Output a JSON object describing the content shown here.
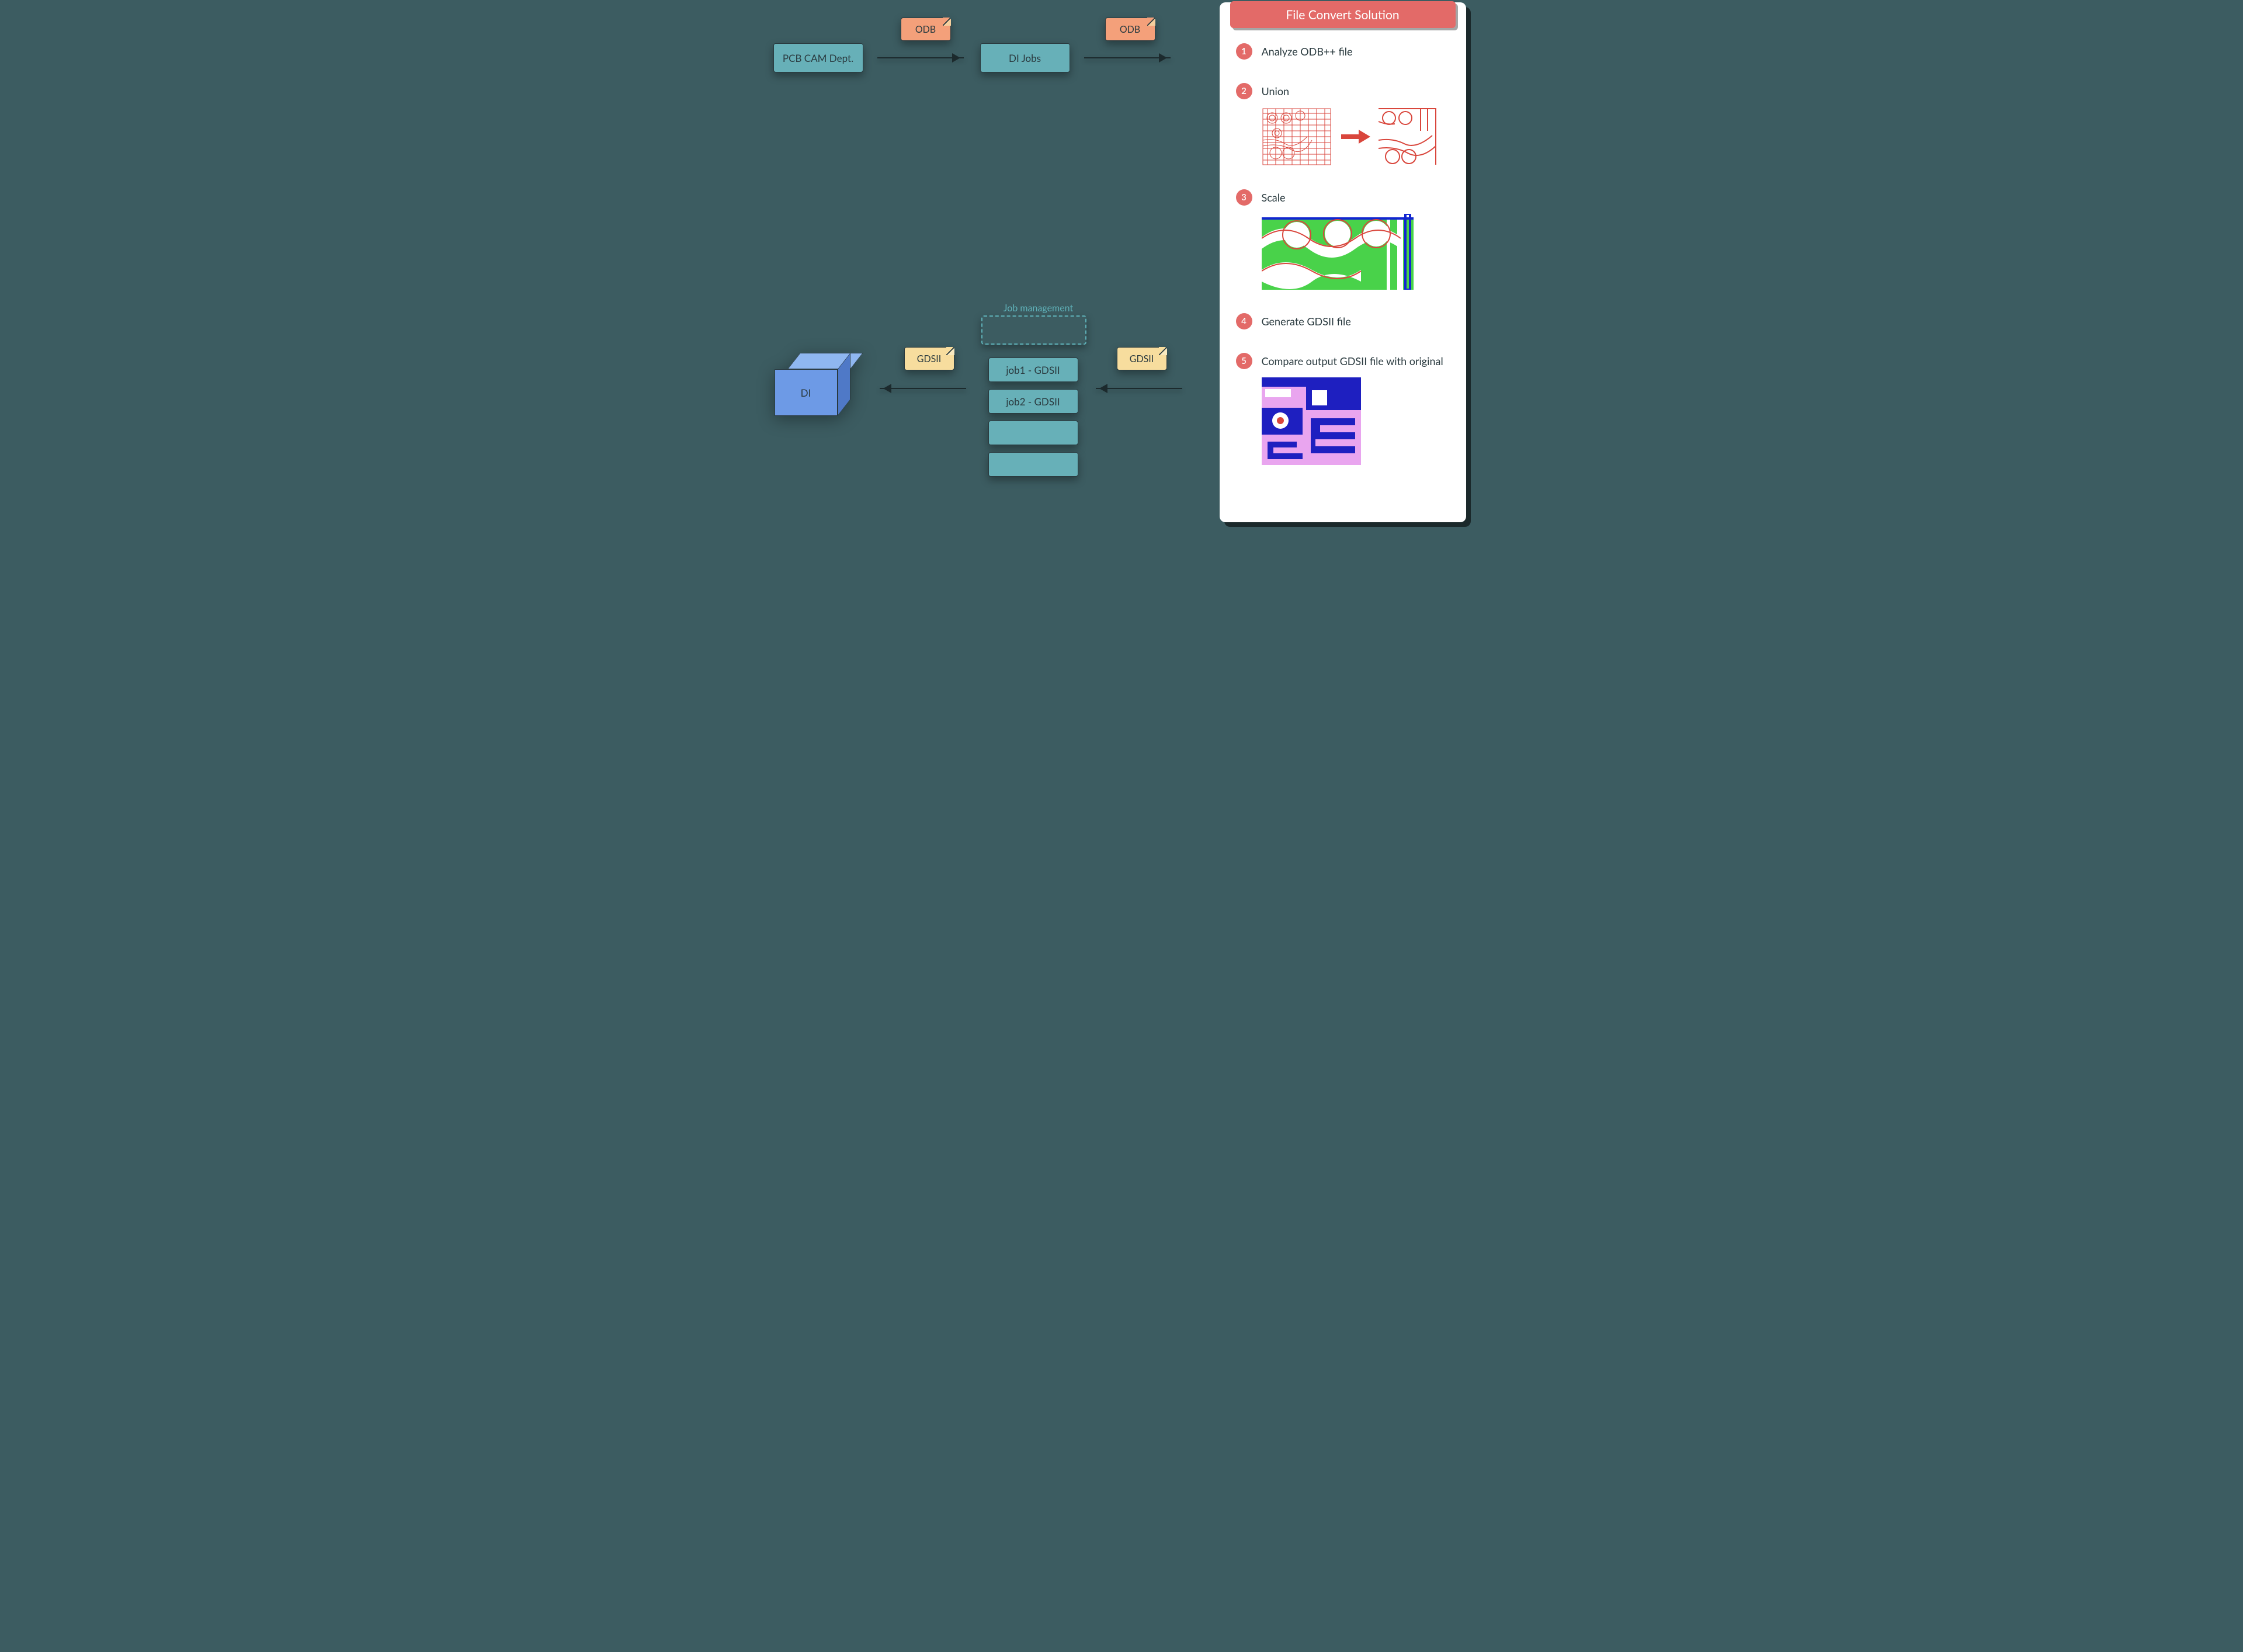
{
  "flow": {
    "pcb_cam": "PCB CAM Dept.",
    "di_jobs": "DI Jobs",
    "odb_label": "ODB",
    "gdsii_label": "GDSII",
    "job_mgmt_label": "Job management",
    "jobs": [
      "job1 - GDSII",
      "job2 - GDSII",
      "",
      ""
    ],
    "di_cube": "DI"
  },
  "card": {
    "title": "File Convert Solution",
    "steps": [
      {
        "n": "1",
        "title": "Analyze ODB++ file"
      },
      {
        "n": "2",
        "title": "Union"
      },
      {
        "n": "3",
        "title": "Scale"
      },
      {
        "n": "4",
        "title": "Generate GDSII file"
      },
      {
        "n": "5",
        "title": "Compare output GDSII file with original"
      }
    ]
  }
}
